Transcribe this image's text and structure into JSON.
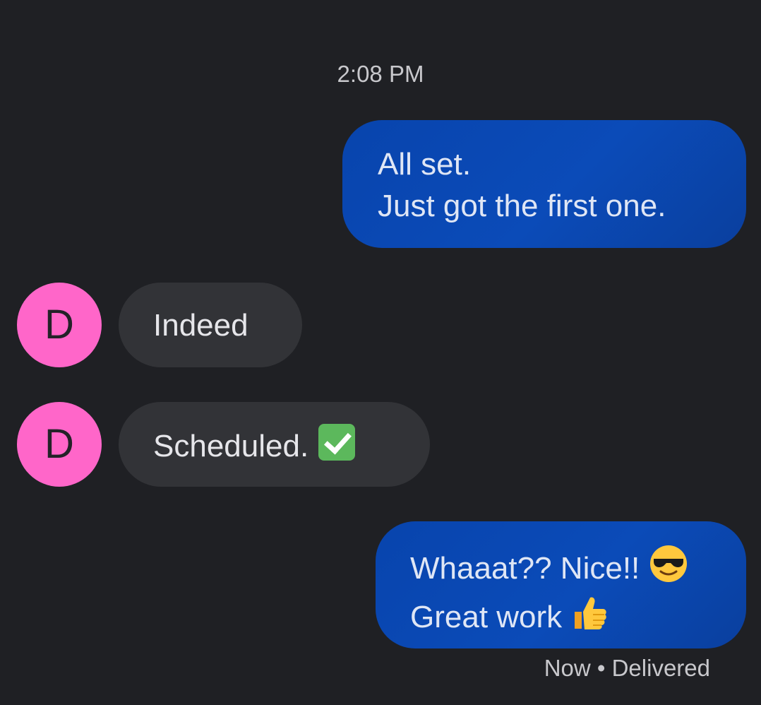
{
  "conversation": {
    "timestamp": "2:08 PM",
    "messages": [
      {
        "direction": "outgoing",
        "lines": [
          "All set.",
          "Just got the first one."
        ]
      },
      {
        "direction": "incoming",
        "sender_initial": "D",
        "lines": [
          "Indeed"
        ]
      },
      {
        "direction": "incoming",
        "sender_initial": "D",
        "text": "Scheduled.",
        "emoji": "check-mark-button-icon"
      },
      {
        "direction": "outgoing",
        "lines": [
          "Whaaat?? Nice!!",
          "Great work"
        ],
        "emojis": [
          "smiling-face-with-sunglasses-icon",
          "thumbs-up-icon"
        ]
      }
    ],
    "status": "Now • Delivered"
  },
  "colors": {
    "background": "#1f2024",
    "outgoing_bubble": "#0b4bb8",
    "incoming_bubble": "#323337",
    "avatar": "#ff66c9"
  }
}
